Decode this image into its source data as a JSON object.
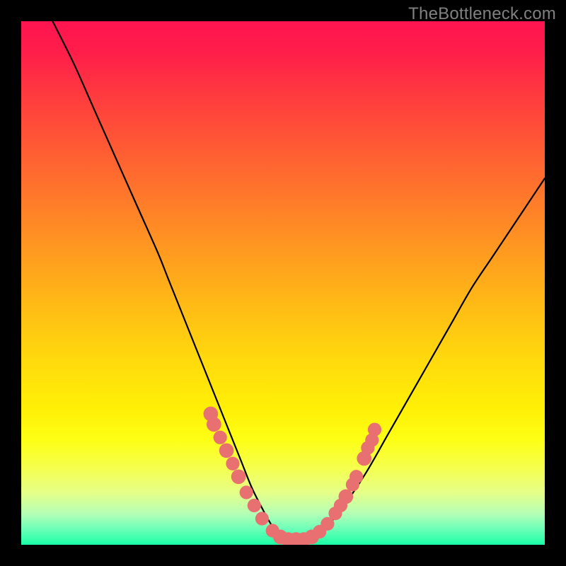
{
  "watermark": "TheBottleneck.com",
  "chart_data": {
    "type": "line",
    "title": "",
    "xlabel": "",
    "ylabel": "",
    "xlim": [
      0,
      100
    ],
    "ylim": [
      0,
      100
    ],
    "grid": false,
    "series": [
      {
        "name": "curve",
        "color": "#000000",
        "x": [
          6,
          10,
          14,
          18,
          22,
          26,
          28,
          30,
          32,
          34,
          36,
          38,
          40,
          42,
          44,
          46,
          48,
          50,
          52,
          54,
          56,
          58,
          62,
          66,
          70,
          74,
          78,
          82,
          86,
          90,
          94,
          98,
          100
        ],
        "values": [
          100,
          92,
          83,
          74,
          65,
          56,
          51,
          46,
          41,
          36,
          31,
          26,
          21,
          16,
          11,
          7,
          3.5,
          1.5,
          0.5,
          0.5,
          1.5,
          3,
          8,
          14,
          21,
          28,
          35,
          42,
          49,
          55,
          61,
          67,
          70
        ]
      }
    ],
    "markers": [
      {
        "name": "dots",
        "color": "#e97070",
        "points": [
          {
            "x": 36.2,
            "y": 25.0,
            "r": 1.4
          },
          {
            "x": 36.8,
            "y": 23.0,
            "r": 1.4
          },
          {
            "x": 38.0,
            "y": 20.5,
            "r": 1.3
          },
          {
            "x": 39.2,
            "y": 18.0,
            "r": 1.4
          },
          {
            "x": 40.4,
            "y": 15.5,
            "r": 1.3
          },
          {
            "x": 41.5,
            "y": 13.0,
            "r": 1.4
          },
          {
            "x": 43.0,
            "y": 10.0,
            "r": 1.3
          },
          {
            "x": 44.5,
            "y": 7.5,
            "r": 1.3
          },
          {
            "x": 46.0,
            "y": 5.0,
            "r": 1.3
          },
          {
            "x": 48.0,
            "y": 2.7,
            "r": 1.3
          },
          {
            "x": 49.5,
            "y": 1.5,
            "r": 1.4
          },
          {
            "x": 51.0,
            "y": 1.0,
            "r": 1.4
          },
          {
            "x": 52.5,
            "y": 1.0,
            "r": 1.4
          },
          {
            "x": 54.0,
            "y": 1.0,
            "r": 1.4
          },
          {
            "x": 55.5,
            "y": 1.5,
            "r": 1.4
          },
          {
            "x": 57.0,
            "y": 2.5,
            "r": 1.3
          },
          {
            "x": 58.5,
            "y": 4.0,
            "r": 1.3
          },
          {
            "x": 60.0,
            "y": 6.0,
            "r": 1.3
          },
          {
            "x": 61.0,
            "y": 7.5,
            "r": 1.3
          },
          {
            "x": 62.0,
            "y": 9.2,
            "r": 1.4
          },
          {
            "x": 63.3,
            "y": 11.5,
            "r": 1.3
          },
          {
            "x": 64.0,
            "y": 13.0,
            "r": 1.3
          },
          {
            "x": 65.5,
            "y": 16.5,
            "r": 1.4
          },
          {
            "x": 66.2,
            "y": 18.5,
            "r": 1.3
          },
          {
            "x": 67.0,
            "y": 20.0,
            "r": 1.3
          },
          {
            "x": 67.5,
            "y": 22.0,
            "r": 1.3
          }
        ]
      }
    ]
  }
}
